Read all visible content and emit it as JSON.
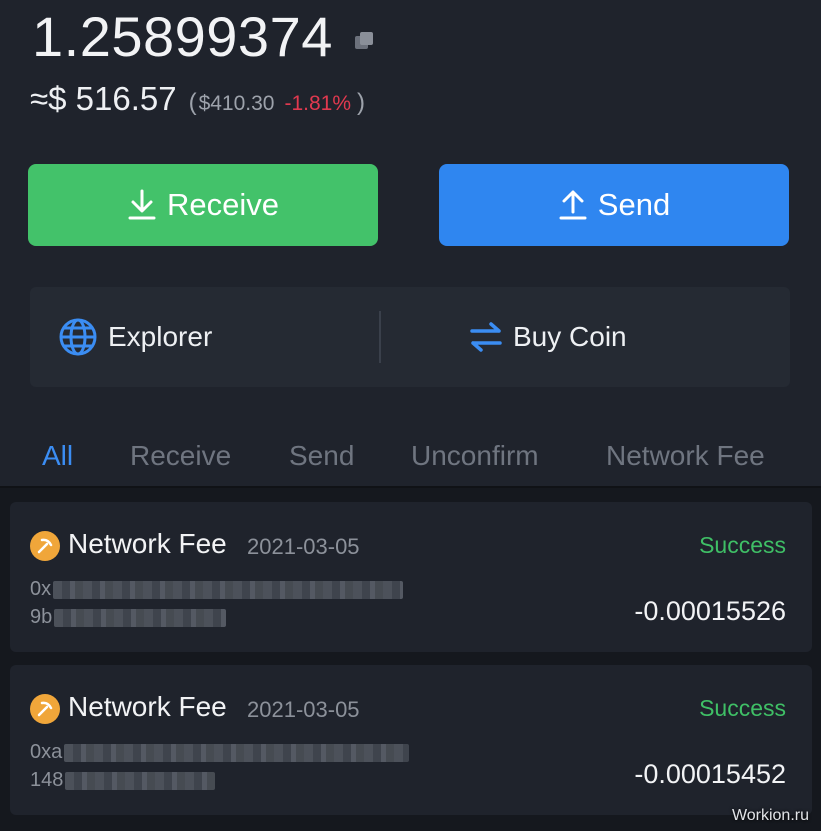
{
  "wallet": {
    "balance": "1.25899374",
    "fiat_value": "≈$ 516.57",
    "paren_open": "(",
    "paren_close": ")",
    "price": "$410.30",
    "change": "-1.81%",
    "change_color": "#e0394f"
  },
  "buttons": {
    "receive_label": "Receive",
    "send_label": "Send",
    "receive_color": "#43c26a",
    "send_color": "#2f86f0"
  },
  "actions": {
    "explorer_label": "Explorer",
    "buy_coin_label": "Buy Coin"
  },
  "tabs": [
    {
      "label": "All",
      "active": true
    },
    {
      "label": "Receive",
      "active": false
    },
    {
      "label": "Send",
      "active": false
    },
    {
      "label": "Unconfirm",
      "active": false
    },
    {
      "label": "Network Fee",
      "active": false
    }
  ],
  "transactions": [
    {
      "title": "Network Fee",
      "date": "2021-03-05",
      "status": "Success",
      "hash_line1_prefix": "0x",
      "hash_line2_prefix": "9b",
      "amount": "-0.00015526",
      "icon": "coin-icon"
    },
    {
      "title": "Network Fee",
      "date": "2021-03-05",
      "status": "Success",
      "hash_line1_prefix": "0xa",
      "hash_line2_prefix": "148",
      "amount": "-0.00015452",
      "icon": "coin-icon"
    }
  ],
  "watermark": "Workion.ru"
}
